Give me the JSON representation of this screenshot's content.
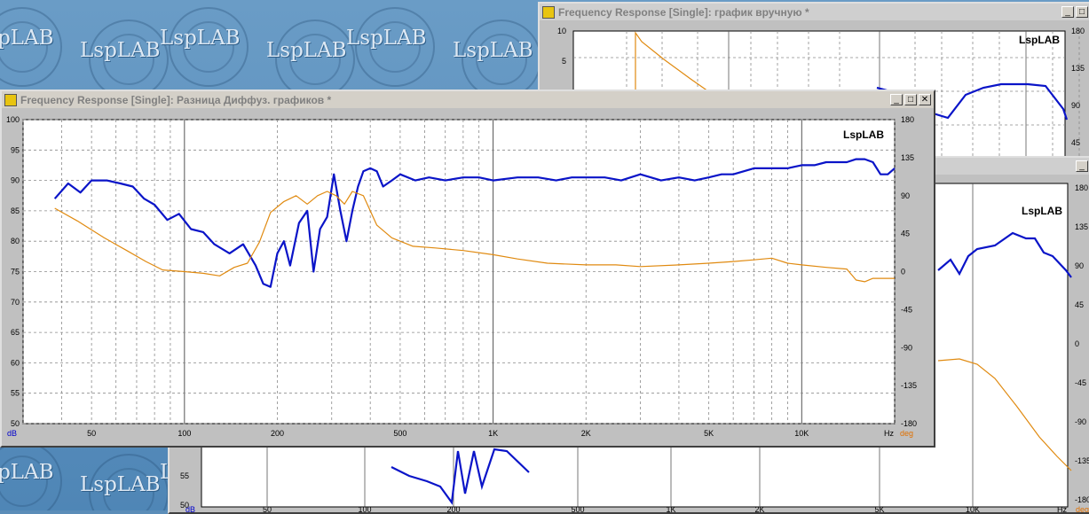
{
  "desktop": {
    "watermark": "LspLAB"
  },
  "windows": {
    "back_top": {
      "title": "Frequency Response [Single]: график вручную  *"
    },
    "main": {
      "title": "Frequency Response [Single]: Разница Диффуз. графиков  *"
    },
    "buttons": {
      "minimize": "_",
      "maximize": "□",
      "close": "✕"
    }
  },
  "colors": {
    "magnitude": "#0a14c8",
    "phase": "#e08a10",
    "grid": "#8a8a8a",
    "db_label": "#0000cc",
    "deg_label": "#e07000"
  },
  "chart_data": [
    {
      "type": "line",
      "window": "main",
      "watermark": "LspLAB",
      "xscale": "log",
      "xlim": [
        30,
        20000
      ],
      "x_ticks": [
        50,
        100,
        200,
        500,
        1000,
        2000,
        5000,
        10000
      ],
      "x_tick_labels": [
        "50",
        "100",
        "200",
        "500",
        "1K",
        "2K",
        "5K",
        "10K"
      ],
      "x_unit": "Hz",
      "ylim_left": [
        50,
        100
      ],
      "y_ticks_left": [
        "100",
        "95",
        "90",
        "85",
        "80",
        "75",
        "70",
        "65",
        "60",
        "55",
        "50"
      ],
      "y_unit_left": "dB",
      "ylim_right": [
        -180,
        180
      ],
      "y_ticks_right": [
        "180",
        "135",
        "90",
        "45",
        "0",
        "-45",
        "-90",
        "-135",
        "-180"
      ],
      "y_unit_right": "deg",
      "grid": true,
      "series": [
        {
          "axis": "left",
          "color": "#0a14c8",
          "x": [
            38,
            42,
            46,
            50,
            56,
            62,
            68,
            74,
            80,
            88,
            96,
            105,
            115,
            125,
            140,
            155,
            170,
            180,
            190,
            200,
            210,
            220,
            235,
            250,
            262,
            275,
            290,
            305,
            320,
            335,
            350,
            365,
            380,
            400,
            420,
            440,
            470,
            500,
            560,
            620,
            700,
            800,
            900,
            1000,
            1200,
            1400,
            1600,
            1800,
            2000,
            2300,
            2600,
            3000,
            3500,
            4000,
            4500,
            5000,
            5500,
            6000,
            7000,
            8000,
            9000,
            10000,
            11000,
            12000,
            13000,
            14000,
            15000,
            16000,
            17000,
            18000,
            19000,
            20000
          ],
          "y": [
            87,
            89.5,
            88,
            90,
            90,
            89.5,
            89,
            87,
            86,
            83.5,
            84.5,
            82,
            81.5,
            79.5,
            78,
            79.5,
            76,
            73,
            72.5,
            78,
            80,
            76,
            83,
            85,
            75,
            82,
            84,
            91,
            85,
            80,
            85,
            89,
            91.5,
            92,
            91.5,
            89,
            90,
            91,
            90,
            90.5,
            90,
            90.5,
            90.5,
            90,
            90.5,
            90.5,
            90,
            90.5,
            90.5,
            90.5,
            90,
            91,
            90,
            90.5,
            90,
            90.5,
            91,
            91,
            92,
            92,
            92,
            92.5,
            92.5,
            93,
            93,
            93,
            93.5,
            93.5,
            93,
            91,
            91,
            92
          ]
        },
        {
          "axis": "right",
          "color": "#e08a10",
          "x": [
            38,
            45,
            55,
            65,
            75,
            85,
            100,
            115,
            130,
            145,
            160,
            175,
            190,
            210,
            230,
            250,
            270,
            290,
            310,
            330,
            350,
            380,
            420,
            470,
            550,
            650,
            800,
            1000,
            1200,
            1500,
            2000,
            2500,
            3000,
            4000,
            5000,
            6000,
            7000,
            8000,
            9000,
            10000,
            12000,
            14000,
            15000,
            16000,
            17000,
            18000,
            20000
          ],
          "y": [
            75,
            60,
            40,
            25,
            12,
            2,
            0,
            -2,
            -5,
            5,
            10,
            35,
            70,
            83,
            90,
            80,
            90,
            95,
            90,
            80,
            95,
            90,
            55,
            40,
            30,
            28,
            25,
            20,
            15,
            10,
            8,
            8,
            6,
            8,
            10,
            12,
            14,
            16,
            10,
            8,
            5,
            3,
            -10,
            -12,
            -8,
            -8,
            -8
          ]
        }
      ]
    },
    {
      "type": "line",
      "window": "back_top",
      "watermark": "LspLAB",
      "y_ticks_left": [
        "10",
        "5"
      ],
      "y_ticks_right": [
        "180",
        "135",
        "90",
        "45"
      ]
    },
    {
      "type": "line",
      "window": "back_bottom",
      "watermark": "LspLAB",
      "xscale": "log",
      "x_tick_labels": [
        "50",
        "100",
        "200",
        "500",
        "1K",
        "2K",
        "5K",
        "10K"
      ],
      "x_unit": "Hz",
      "y_unit_left": "dB",
      "y_ticks_left": [
        "55",
        "50"
      ],
      "y_ticks_right": [
        "180",
        "135",
        "90",
        "45",
        "0",
        "-45",
        "-90",
        "-135",
        "-180"
      ],
      "y_unit_right": "deg"
    }
  ]
}
